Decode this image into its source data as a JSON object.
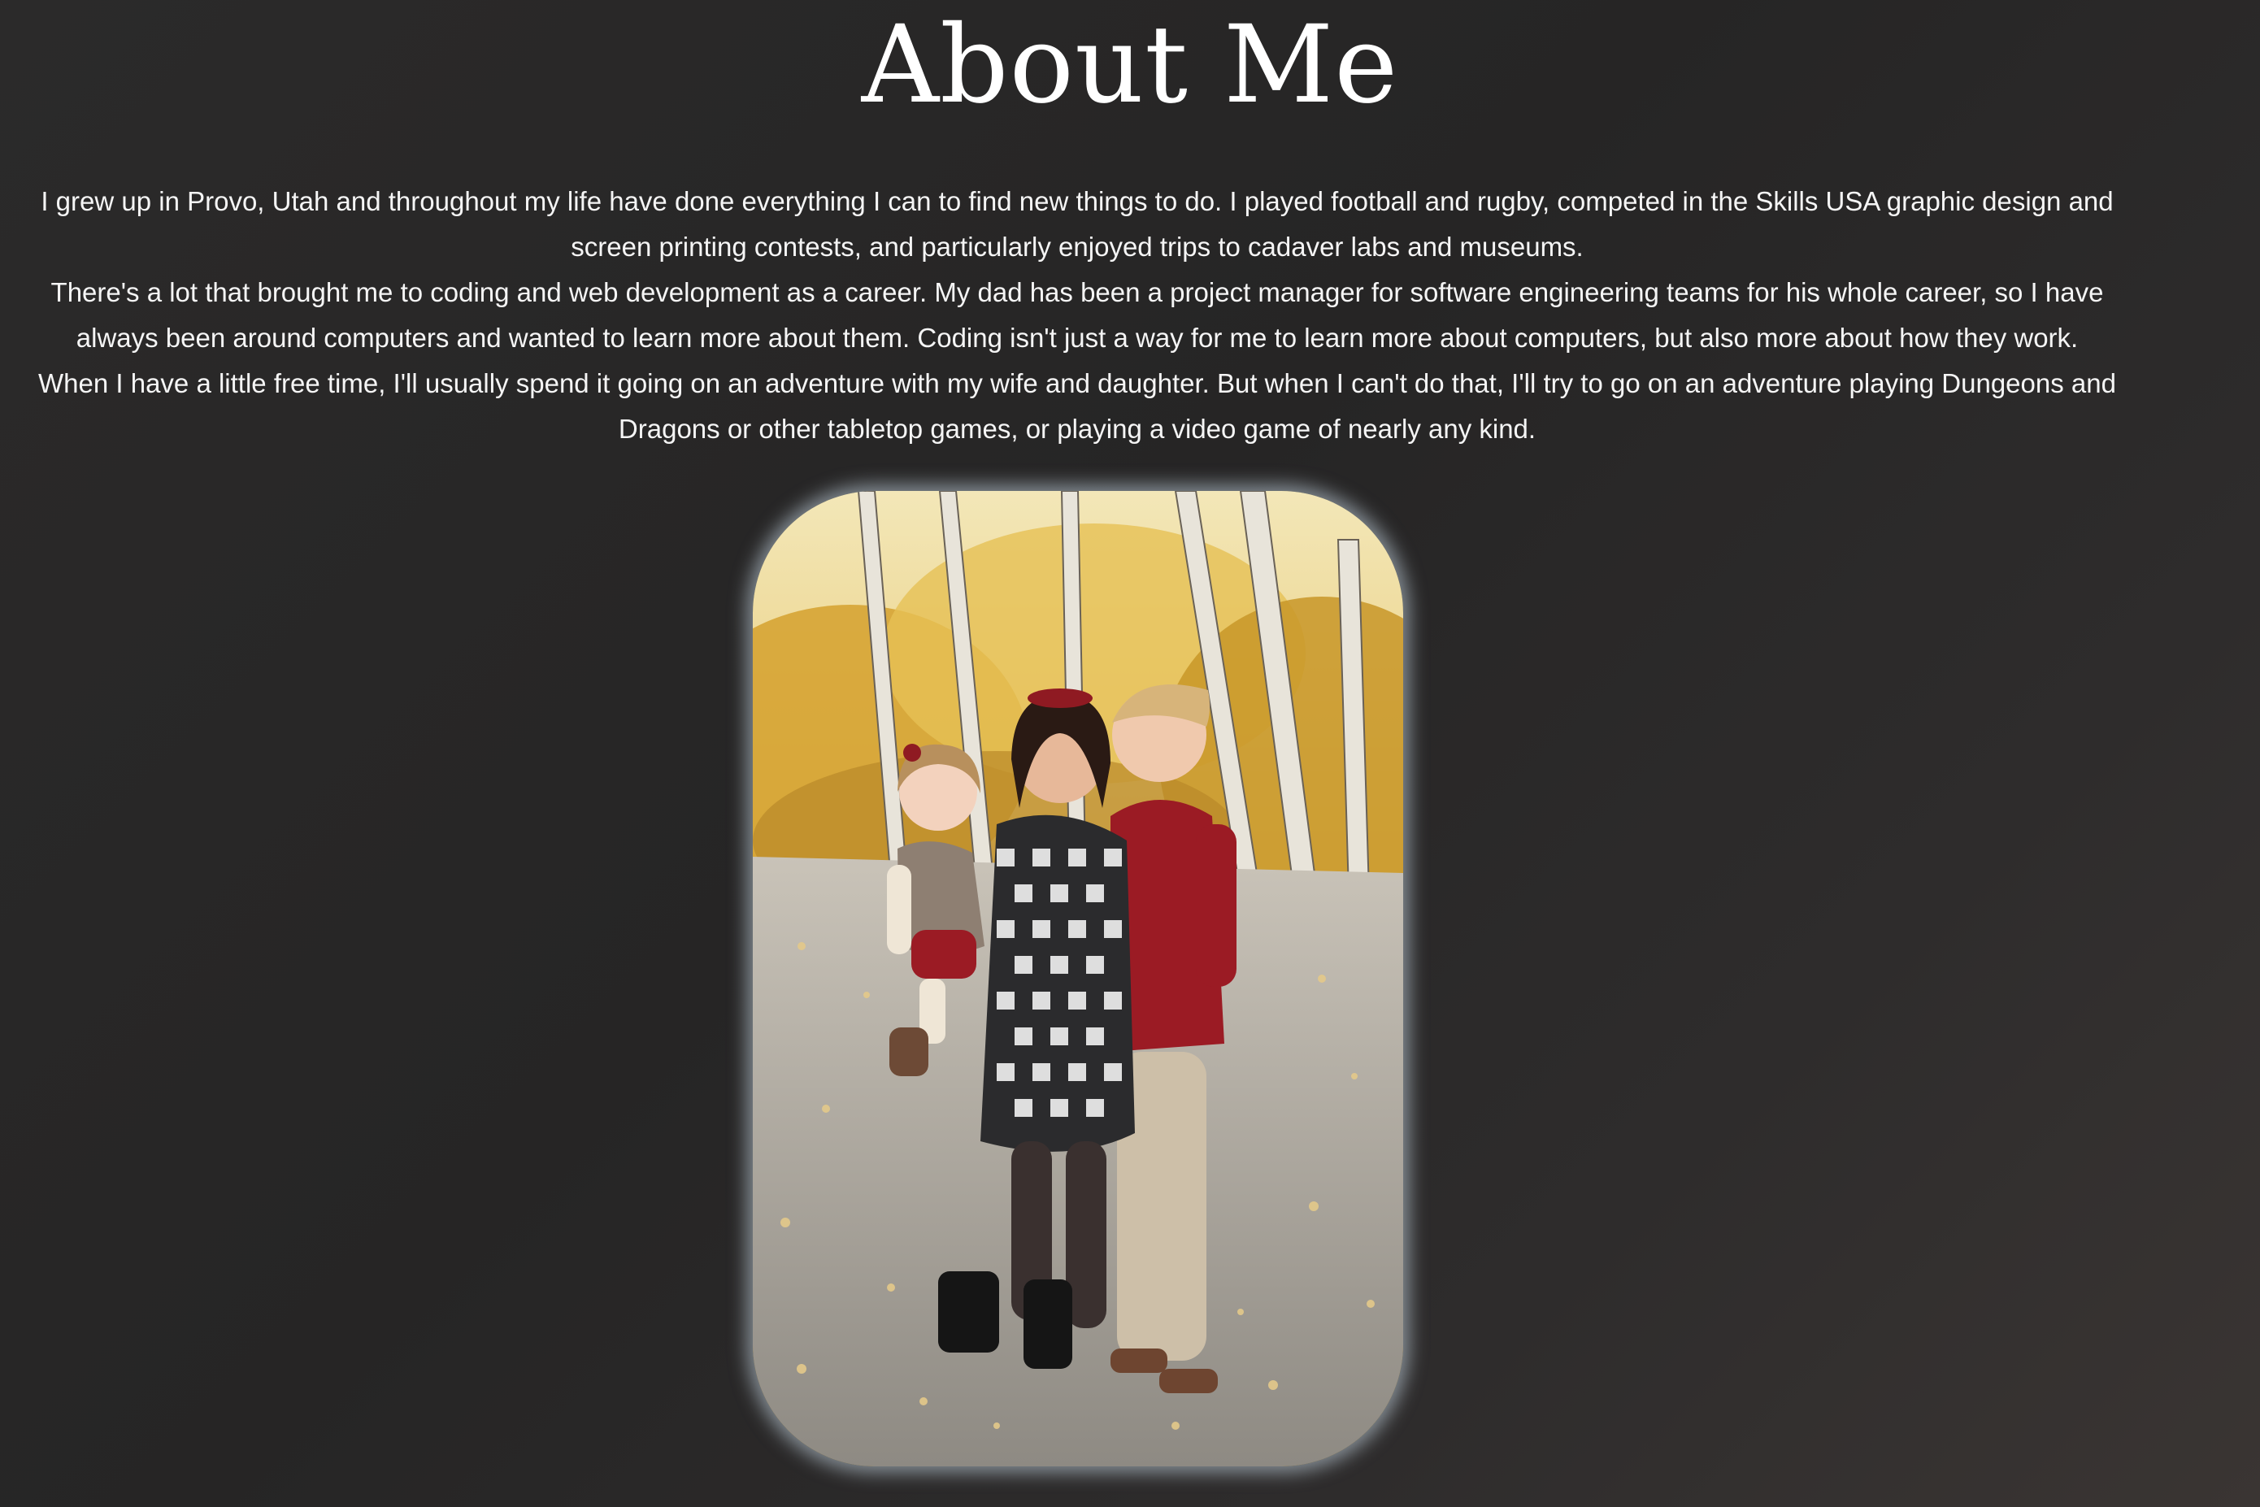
{
  "page": {
    "title": "About Me"
  },
  "bio": {
    "paragraphs": [
      "I grew up in Provo, Utah and throughout my life have done everything I can to find new things to do. I played football and rugby, competed in the Skills USA graphic design and screen printing contests, and particularly enjoyed trips to cadaver labs and museums.",
      "There's a lot that brought me to coding and web development as a career. My dad has been a project manager for software engineering teams for his whole career, so I have always been around computers and wanted to learn more about them. Coding isn't just a way for me to learn more about computers, but also more about how they work.",
      "When I have a little free time, I'll usually spend it going on an adventure with my wife and daughter. But when I can't do that, I'll try to go on an adventure playing Dungeons and Dragons or other tabletop games, or playing a video game of nearly any kind."
    ]
  },
  "photo": {
    "subject": "family-photo",
    "colors": {
      "glow": "#cddeeb",
      "foliage": "#d9a935",
      "sweater": "#9b1b24",
      "path": "#b9b4ab"
    }
  }
}
